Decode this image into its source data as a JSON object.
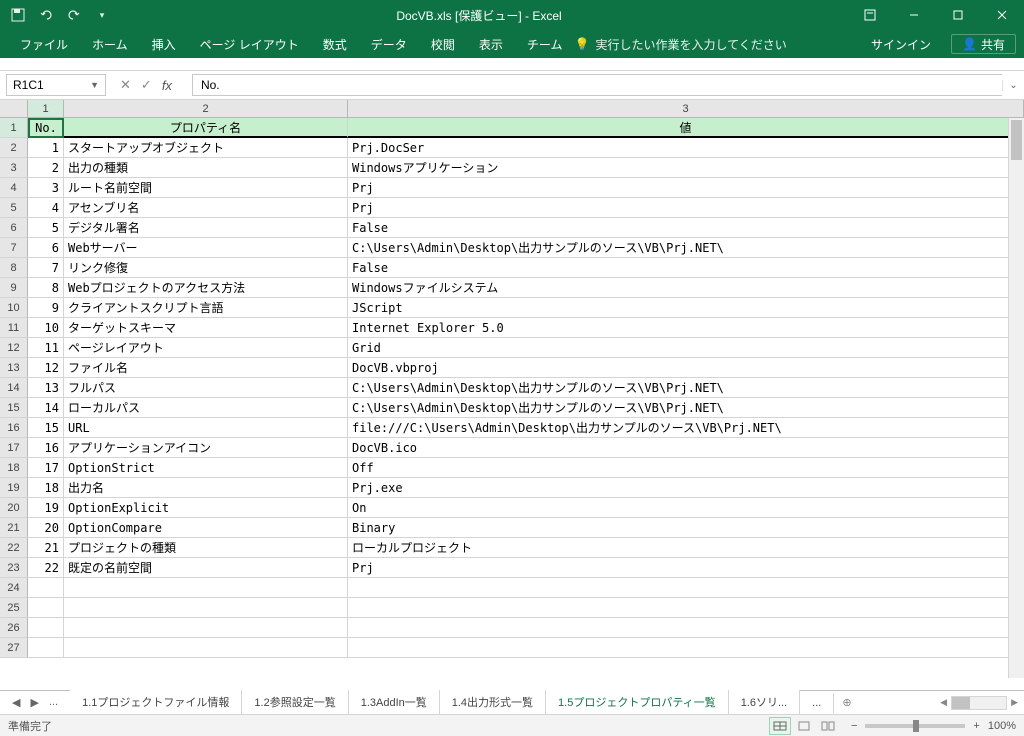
{
  "title": "DocVB.xls [保護ビュー] - Excel",
  "qat": {
    "save": "保存",
    "undo": "元に戻す",
    "redo": "やり直し"
  },
  "ribbon": {
    "tabs": [
      "ファイル",
      "ホーム",
      "挿入",
      "ページ レイアウト",
      "数式",
      "データ",
      "校閲",
      "表示",
      "チーム"
    ],
    "tellme": "実行したい作業を入力してください",
    "signin": "サインイン",
    "share": "共有"
  },
  "namebox": "R1C1",
  "formula": "No.",
  "columns": [
    "1",
    "2",
    "3"
  ],
  "headers": {
    "no": "No.",
    "prop": "プロパティ名",
    "val": "値"
  },
  "rows": [
    {
      "n": "1",
      "p": "スタートアップオブジェクト",
      "v": "Prj.DocSer"
    },
    {
      "n": "2",
      "p": "出力の種類",
      "v": "Windowsアプリケーション"
    },
    {
      "n": "3",
      "p": "ルート名前空間",
      "v": "Prj"
    },
    {
      "n": "4",
      "p": "アセンブリ名",
      "v": "Prj"
    },
    {
      "n": "5",
      "p": "デジタル署名",
      "v": "False"
    },
    {
      "n": "6",
      "p": "Webサーバー",
      "v": "C:\\Users\\Admin\\Desktop\\出力サンプルのソース\\VB\\Prj.NET\\"
    },
    {
      "n": "7",
      "p": "リンク修復",
      "v": "False"
    },
    {
      "n": "8",
      "p": "Webプロジェクトのアクセス方法",
      "v": "Windowsファイルシステム"
    },
    {
      "n": "9",
      "p": "クライアントスクリプト言語",
      "v": "JScript"
    },
    {
      "n": "10",
      "p": "ターゲットスキーマ",
      "v": "Internet Explorer 5.0"
    },
    {
      "n": "11",
      "p": "ページレイアウト",
      "v": "Grid"
    },
    {
      "n": "12",
      "p": "ファイル名",
      "v": "DocVB.vbproj"
    },
    {
      "n": "13",
      "p": "フルパス",
      "v": "C:\\Users\\Admin\\Desktop\\出力サンプルのソース\\VB\\Prj.NET\\"
    },
    {
      "n": "14",
      "p": "ローカルパス",
      "v": "C:\\Users\\Admin\\Desktop\\出力サンプルのソース\\VB\\Prj.NET\\"
    },
    {
      "n": "15",
      "p": "URL",
      "v": "file:///C:\\Users\\Admin\\Desktop\\出力サンプルのソース\\VB\\Prj.NET\\"
    },
    {
      "n": "16",
      "p": "アプリケーションアイコン",
      "v": "DocVB.ico"
    },
    {
      "n": "17",
      "p": "OptionStrict",
      "v": "Off"
    },
    {
      "n": "18",
      "p": "出力名",
      "v": "Prj.exe"
    },
    {
      "n": "19",
      "p": "OptionExplicit",
      "v": "On"
    },
    {
      "n": "20",
      "p": "OptionCompare",
      "v": "Binary"
    },
    {
      "n": "21",
      "p": "プロジェクトの種類",
      "v": "ローカルプロジェクト"
    },
    {
      "n": "22",
      "p": "既定の名前空間",
      "v": "Prj"
    }
  ],
  "emptyRows": [
    "24",
    "25",
    "26",
    "27"
  ],
  "sheets": {
    "ellipsis": "...",
    "tabs": [
      "1.1プロジェクトファイル情報",
      "1.2参照設定一覧",
      "1.3AddIn一覧",
      "1.4出力形式一覧",
      "1.5プロジェクトプロパティ一覧",
      "1.6ソリ..."
    ],
    "activeIndex": 4,
    "more": "..."
  },
  "status": {
    "ready": "準備完了",
    "zoom": "100%"
  }
}
